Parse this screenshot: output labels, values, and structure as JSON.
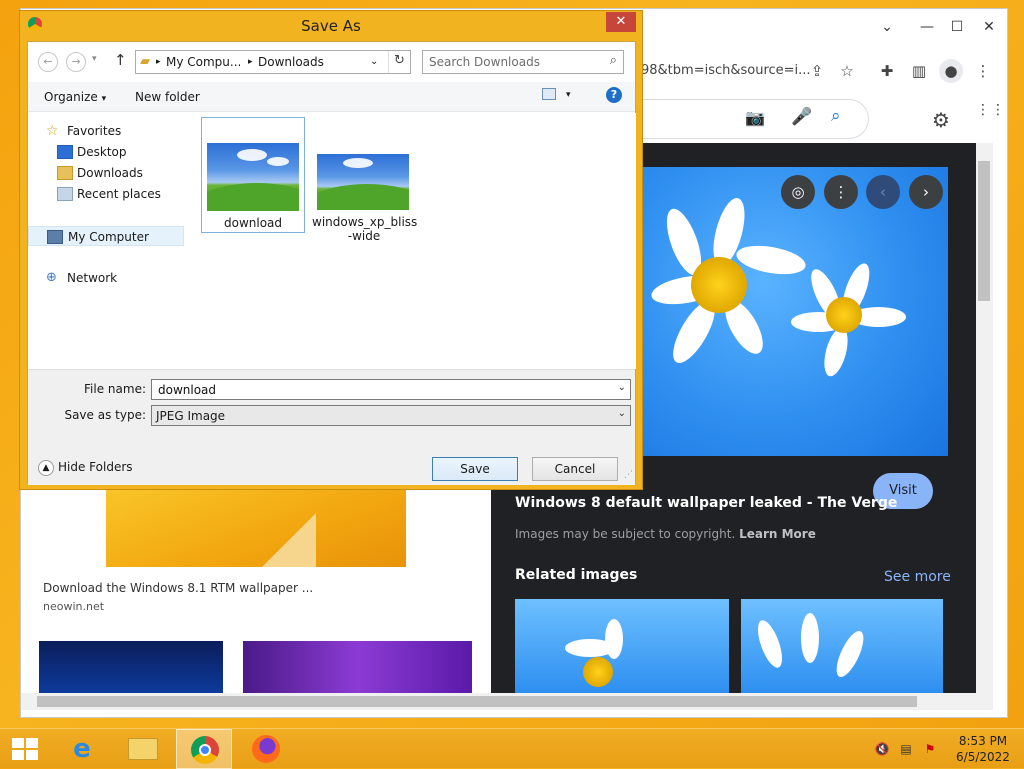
{
  "chrome": {
    "url_tail": "98&tbm=isch&source=i...",
    "minimize": "—",
    "maximize": "☐",
    "close": "✕",
    "dropdown": "⌄",
    "left_result": {
      "caption": "Download the Windows 8.1 RTM wallpaper ...",
      "source": "neowin.net"
    },
    "panel": {
      "title": "Windows 8 default wallpaper leaked - The Verge",
      "copyright_text": "Images may be subject to copyright.",
      "learn_more": "Learn More",
      "visit_label": "Visit",
      "related_label": "Related images",
      "see_more": "See more"
    }
  },
  "dialog": {
    "title": "Save As",
    "close_label": "✕",
    "breadcrumb": {
      "root": "My Compu...",
      "sep": "▸",
      "folder": "Downloads"
    },
    "search_placeholder": "Search Downloads",
    "organize_label": "Organize",
    "new_folder_label": "New folder",
    "help_label": "?",
    "tree": {
      "favorites": "Favorites",
      "desktop": "Desktop",
      "downloads": "Downloads",
      "recent": "Recent places",
      "computer": "My Computer",
      "network": "Network"
    },
    "files": [
      {
        "name": "download"
      },
      {
        "name": "windows_xp_bliss",
        "name2": "-wide"
      }
    ],
    "file_name_label": "File name:",
    "file_name_value": "download",
    "save_type_label": "Save as type:",
    "save_type_value": "JPEG Image",
    "hide_folders": "Hide Folders",
    "save_button": "Save",
    "cancel_button": "Cancel"
  },
  "taskbar": {
    "time": "8:53 PM",
    "date": "6/5/2022"
  },
  "colors": {
    "desktop": "#f2a60f",
    "chrome_panel": "#202124",
    "link_blue": "#8ab4f8",
    "dialog_frame": "#f2b320",
    "close_red": "#c7463a"
  }
}
